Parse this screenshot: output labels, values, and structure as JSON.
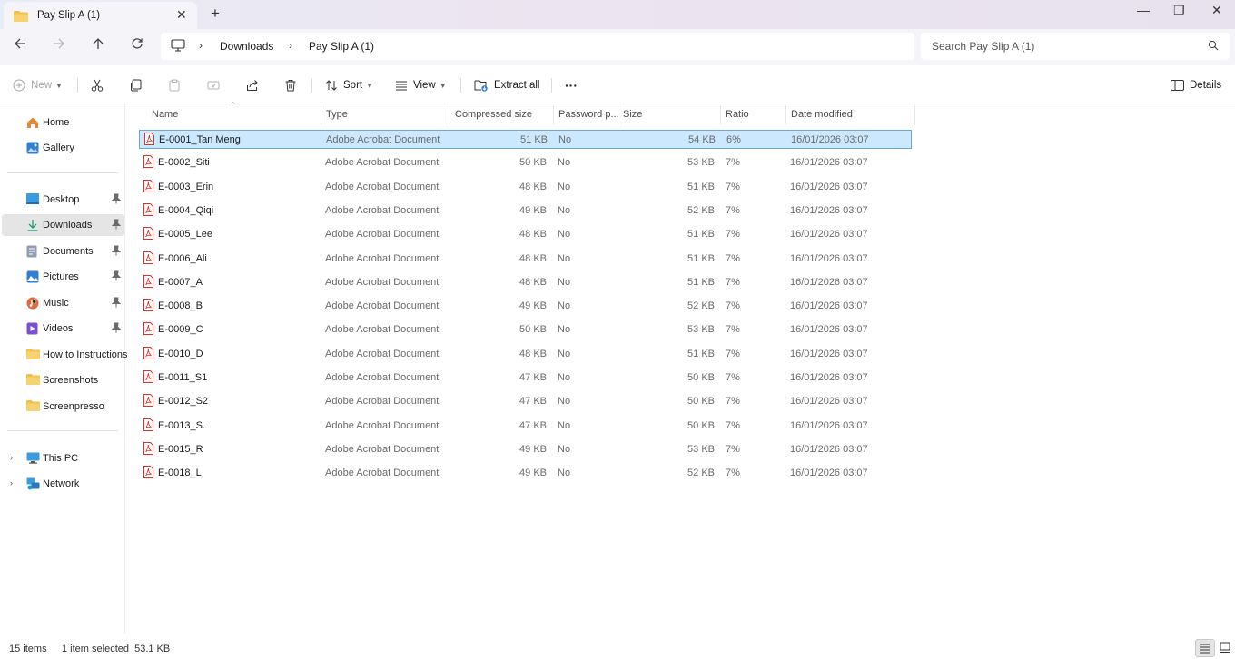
{
  "window": {
    "tab_title": "Pay Slip A (1)",
    "new_tab": "+",
    "min": "—",
    "max": "❐",
    "close": "✕"
  },
  "address": {
    "crumbs": [
      "Downloads",
      "Pay Slip A (1)"
    ],
    "search_placeholder": "Search Pay Slip A (1)"
  },
  "toolbar": {
    "new_label": "New",
    "sort_label": "Sort",
    "view_label": "View",
    "extract_label": "Extract all",
    "more_label": "···",
    "details_label": "Details"
  },
  "sidebar": {
    "items": [
      {
        "label": "Home",
        "icon": "home-icon"
      },
      {
        "label": "Gallery",
        "icon": "gallery-icon"
      },
      {
        "label": "Desktop",
        "icon": "desktop-icon",
        "pinned": true
      },
      {
        "label": "Downloads",
        "icon": "download-icon",
        "pinned": true,
        "selected": true
      },
      {
        "label": "Documents",
        "icon": "documents-icon",
        "pinned": true
      },
      {
        "label": "Pictures",
        "icon": "pictures-icon",
        "pinned": true
      },
      {
        "label": "Music",
        "icon": "music-icon",
        "pinned": true
      },
      {
        "label": "Videos",
        "icon": "videos-icon",
        "pinned": true
      },
      {
        "label": "How to Instructions",
        "icon": "folder-icon"
      },
      {
        "label": "Screenshots",
        "icon": "folder-icon"
      },
      {
        "label": "Screenpresso",
        "icon": "folder-icon"
      },
      {
        "label": "This PC",
        "icon": "this-pc-icon"
      },
      {
        "label": "Network",
        "icon": "network-icon"
      }
    ]
  },
  "columns": [
    "Name",
    "Type",
    "Compressed size",
    "Password p...",
    "Size",
    "Ratio",
    "Date modified"
  ],
  "files": [
    {
      "name": "E-0001_Tan Meng",
      "type": "Adobe Acrobat Document",
      "compressed": "51 KB",
      "password": "No",
      "size": "54 KB",
      "ratio": "6%",
      "date": "16/01/2026 03:07"
    },
    {
      "name": "E-0002_Siti",
      "type": "Adobe Acrobat Document",
      "compressed": "50 KB",
      "password": "No",
      "size": "53 KB",
      "ratio": "7%",
      "date": "16/01/2026 03:07"
    },
    {
      "name": "E-0003_Erin",
      "type": "Adobe Acrobat Document",
      "compressed": "48 KB",
      "password": "No",
      "size": "51 KB",
      "ratio": "7%",
      "date": "16/01/2026 03:07"
    },
    {
      "name": "E-0004_Qiqi",
      "type": "Adobe Acrobat Document",
      "compressed": "49 KB",
      "password": "No",
      "size": "52 KB",
      "ratio": "7%",
      "date": "16/01/2026 03:07"
    },
    {
      "name": "E-0005_Lee",
      "type": "Adobe Acrobat Document",
      "compressed": "48 KB",
      "password": "No",
      "size": "51 KB",
      "ratio": "7%",
      "date": "16/01/2026 03:07"
    },
    {
      "name": "E-0006_Ali",
      "type": "Adobe Acrobat Document",
      "compressed": "48 KB",
      "password": "No",
      "size": "51 KB",
      "ratio": "7%",
      "date": "16/01/2026 03:07"
    },
    {
      "name": "E-0007_A",
      "type": "Adobe Acrobat Document",
      "compressed": "48 KB",
      "password": "No",
      "size": "51 KB",
      "ratio": "7%",
      "date": "16/01/2026 03:07"
    },
    {
      "name": "E-0008_B",
      "type": "Adobe Acrobat Document",
      "compressed": "49 KB",
      "password": "No",
      "size": "52 KB",
      "ratio": "7%",
      "date": "16/01/2026 03:07"
    },
    {
      "name": "E-0009_C",
      "type": "Adobe Acrobat Document",
      "compressed": "50 KB",
      "password": "No",
      "size": "53 KB",
      "ratio": "7%",
      "date": "16/01/2026 03:07"
    },
    {
      "name": "E-0010_D",
      "type": "Adobe Acrobat Document",
      "compressed": "48 KB",
      "password": "No",
      "size": "51 KB",
      "ratio": "7%",
      "date": "16/01/2026 03:07"
    },
    {
      "name": "E-0011_S1",
      "type": "Adobe Acrobat Document",
      "compressed": "47 KB",
      "password": "No",
      "size": "50 KB",
      "ratio": "7%",
      "date": "16/01/2026 03:07"
    },
    {
      "name": "E-0012_S2",
      "type": "Adobe Acrobat Document",
      "compressed": "47 KB",
      "password": "No",
      "size": "50 KB",
      "ratio": "7%",
      "date": "16/01/2026 03:07"
    },
    {
      "name": "E-0013_S.",
      "type": "Adobe Acrobat Document",
      "compressed": "47 KB",
      "password": "No",
      "size": "50 KB",
      "ratio": "7%",
      "date": "16/01/2026 03:07"
    },
    {
      "name": "E-0015_R",
      "type": "Adobe Acrobat Document",
      "compressed": "49 KB",
      "password": "No",
      "size": "53 KB",
      "ratio": "7%",
      "date": "16/01/2026 03:07"
    },
    {
      "name": "E-0018_L",
      "type": "Adobe Acrobat Document",
      "compressed": "49 KB",
      "password": "No",
      "size": "52 KB",
      "ratio": "7%",
      "date": "16/01/2026 03:07"
    }
  ],
  "status": {
    "item_count": "15 items",
    "selection": "1 item selected  53.1 KB"
  },
  "colors": {
    "selection_bg": "#cce8ff",
    "selection_border": "#6aa5dc",
    "pdf_red": "#d9342b",
    "folder_yellow": "#f3c04a"
  }
}
